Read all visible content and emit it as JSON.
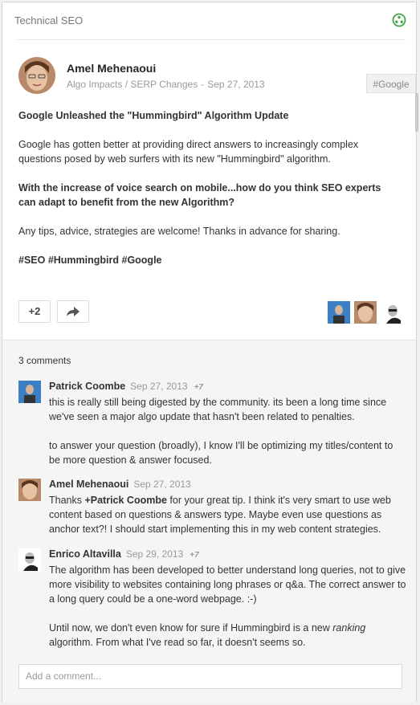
{
  "community": {
    "name": "Technical SEO",
    "icon": "community-icon"
  },
  "post": {
    "author": "Amel Mehenaoui",
    "category": "Algo Impacts / SERP Changes",
    "date": "Sep 27, 2013",
    "tag_badge": "#Google",
    "title": "Google Unleashed the \"Hummingbird\" Algorithm Update",
    "para1": "Google has gotten better at providing direct answers to increasingly complex questions posed by web surfers with its new \"Hummingbird\" algorithm.",
    "question": "With the increase of voice search on mobile...how do you think SEO experts can adapt to benefit from the new Algorithm?",
    "para2": "Any tips, advice, strategies are welcome! Thanks in advance for sharing.",
    "hashtags": "#SEO #Hummingbird #Google"
  },
  "actions": {
    "plus_label": "+2",
    "share_icon": "share-arrow-icon"
  },
  "comments": {
    "count_label": "3 comments",
    "items": [
      {
        "name": "Patrick Coombe",
        "date": "Sep 27, 2013",
        "plus": "+7",
        "p1": "this is really still being digested by the community.  its been a long time since we've seen a major algo update that hasn't been related to penalties.",
        "p2": "to answer your question (broadly), I know I'll be optimizing my titles/content to be more question & answer focused."
      },
      {
        "name": "Amel Mehenaoui",
        "date": "Sep 27, 2013",
        "p_before": "Thanks ",
        "mention": "+Patrick Coombe",
        "p_after": " for your great tip. I think it's very smart to use web content based on questions & answers type. Maybe even use questions as anchor text?! I should start implementing this in my web content strategies."
      },
      {
        "name": "Enrico Altavilla",
        "date": "Sep 29, 2013",
        "plus": "+7",
        "p1": "The algorithm has been developed to better understand long queries, not to give more visibility to websites containing long phrases or q&a. The correct answer to a long query could be a one-word webpage.  :-)",
        "p2_before": "Until now, we don't even know for sure if Hummingbird is a new ",
        "p2_em": "ranking",
        "p2_after": " algorithm. From what I've read so far, it doesn't seems so."
      }
    ],
    "add_placeholder": "Add a comment..."
  },
  "colors": {
    "accent_green": "#4aa64a",
    "text": "#333333",
    "muted": "#999999"
  }
}
